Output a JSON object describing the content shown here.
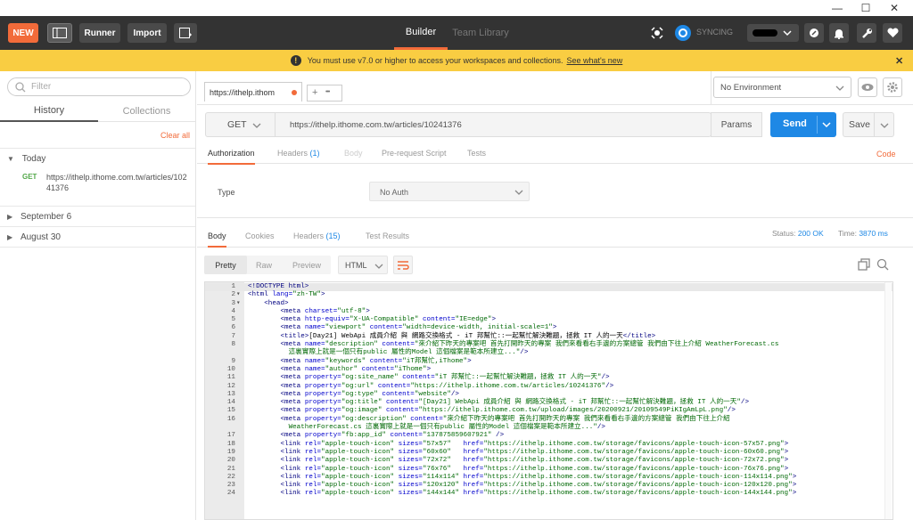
{
  "window": {
    "minimize": "—",
    "maximize": "☐",
    "close": "✕"
  },
  "topbar": {
    "new_label": "NEW",
    "runner_label": "Runner",
    "import_label": "Import",
    "builder_tab": "Builder",
    "team_library_tab": "Team Library",
    "syncing_label": "SYNCING",
    "accent": "#f26b3a",
    "dark": "#333333"
  },
  "banner": {
    "message": "You must use v7.0 or higher to access your workspaces and collections.",
    "link": "See what's new",
    "close": "✕",
    "color": "#f9cd42"
  },
  "sidebar": {
    "filter_placeholder": "Filter",
    "tabs": [
      "History",
      "Collections"
    ],
    "clear_all": "Clear all",
    "groups": [
      {
        "label": "Today",
        "expanded": true,
        "items": [
          {
            "method": "GET",
            "url": "https://ithelp.ithome.com.tw/articles/10241376"
          }
        ]
      },
      {
        "label": "September 6",
        "expanded": false
      },
      {
        "label": "August 30",
        "expanded": false
      }
    ]
  },
  "request_tab": {
    "title": "https://ithelp.ithom",
    "add": "+",
    "more": "•••"
  },
  "environment": {
    "selected": "No Environment"
  },
  "request": {
    "method": "GET",
    "url": "https://ithelp.ithome.com.tw/articles/10241376",
    "params_label": "Params",
    "send_label": "Send",
    "save_label": "Save"
  },
  "request_subtabs": [
    {
      "label": "Authorization",
      "active": true
    },
    {
      "label": "Headers",
      "count": "(1)"
    },
    {
      "label": "Body",
      "disabled": true
    },
    {
      "label": "Pre-request Script"
    },
    {
      "label": "Tests"
    }
  ],
  "code_link": "Code",
  "auth": {
    "type_label": "Type",
    "type_value": "No Auth"
  },
  "response_tabs": [
    {
      "label": "Body",
      "active": true
    },
    {
      "label": "Cookies"
    },
    {
      "label": "Headers",
      "count": "(15)"
    },
    {
      "label": "Test Results"
    }
  ],
  "status": {
    "status_label": "Status:",
    "status_value": "200 OK",
    "time_label": "Time:",
    "time_value": "3870 ms"
  },
  "view_modes": [
    "Pretty",
    "Raw",
    "Preview"
  ],
  "format": "HTML",
  "code_lines": [
    {
      "n": "1",
      "f": "",
      "parts": [
        [
          "t-tag",
          "<!DOCTYPE html>"
        ]
      ]
    },
    {
      "n": "2",
      "f": "▾",
      "parts": [
        [
          "t-tag",
          "<html "
        ],
        [
          "t-attr",
          "lang="
        ],
        [
          "t-val",
          "\"zh-TW\""
        ],
        [
          "t-tag",
          ">"
        ]
      ]
    },
    {
      "n": "3",
      "f": "▾",
      "parts": [
        [
          "t-tag",
          "    <head>"
        ]
      ]
    },
    {
      "n": "4",
      "f": "",
      "parts": [
        [
          "t-tag",
          "        <meta "
        ],
        [
          "t-attr",
          "charset="
        ],
        [
          "t-val",
          "\"utf-8\""
        ],
        [
          "t-tag",
          ">"
        ]
      ]
    },
    {
      "n": "5",
      "f": "",
      "parts": [
        [
          "t-tag",
          "        <meta "
        ],
        [
          "t-attr",
          "http-equiv="
        ],
        [
          "t-val",
          "\"X-UA-Compatible\""
        ],
        [
          "t-attr",
          " content="
        ],
        [
          "t-val",
          "\"IE=edge\""
        ],
        [
          "t-tag",
          ">"
        ]
      ]
    },
    {
      "n": "6",
      "f": "",
      "parts": [
        [
          "t-tag",
          "        <meta "
        ],
        [
          "t-attr",
          "name="
        ],
        [
          "t-val",
          "\"viewport\""
        ],
        [
          "t-attr",
          " content="
        ],
        [
          "t-val",
          "\"width=device-width, initial-scale=1\""
        ],
        [
          "t-tag",
          ">"
        ]
      ]
    },
    {
      "n": "7",
      "f": "",
      "parts": [
        [
          "t-tag",
          "        <title>"
        ],
        [
          "t-txt",
          "[Day21] WebApi 成員介紹 與 網路交換格式 - iT 邦幫忙::一起幫忙解決難題，拯救 IT 人的一天"
        ],
        [
          "t-tag",
          "</title>"
        ]
      ]
    },
    {
      "n": "8",
      "f": "",
      "parts": [
        [
          "t-tag",
          "        <meta "
        ],
        [
          "t-attr",
          "name="
        ],
        [
          "t-val",
          "\"description\""
        ],
        [
          "t-attr",
          " content="
        ],
        [
          "t-val",
          "\"來介紹下昨天的專案吧 首先打開昨天的專案 我們來看看右手邊的方案總管 我們由下往上介紹 WeatherForecast.cs"
        ]
      ]
    },
    {
      "n": "",
      "f": "",
      "parts": [
        [
          "t-val",
          "          這裏實際上就是一個只有public 屬性的Model 這個檔案是範本所建立...\""
        ],
        [
          "t-tag",
          "/>"
        ]
      ]
    },
    {
      "n": "9",
      "f": "",
      "parts": [
        [
          "t-tag",
          "        <meta "
        ],
        [
          "t-attr",
          "name="
        ],
        [
          "t-val",
          "\"keywords\""
        ],
        [
          "t-attr",
          " content="
        ],
        [
          "t-val",
          "\"iT邦幫忙,iThome\""
        ],
        [
          "t-tag",
          ">"
        ]
      ]
    },
    {
      "n": "10",
      "f": "",
      "parts": [
        [
          "t-tag",
          "        <meta "
        ],
        [
          "t-attr",
          "name="
        ],
        [
          "t-val",
          "\"author\""
        ],
        [
          "t-attr",
          " content="
        ],
        [
          "t-val",
          "\"iThome\""
        ],
        [
          "t-tag",
          ">"
        ]
      ]
    },
    {
      "n": "11",
      "f": "",
      "parts": [
        [
          "t-tag",
          "        <meta "
        ],
        [
          "t-attr",
          "property="
        ],
        [
          "t-val",
          "\"og:site_name\""
        ],
        [
          "t-attr",
          " content="
        ],
        [
          "t-val",
          "\"iT 邦幫忙::一起幫忙解決難題，拯救 IT 人的一天\""
        ],
        [
          "t-tag",
          "/>"
        ]
      ]
    },
    {
      "n": "12",
      "f": "",
      "parts": [
        [
          "t-tag",
          "        <meta "
        ],
        [
          "t-attr",
          "property="
        ],
        [
          "t-val",
          "\"og:url\""
        ],
        [
          "t-attr",
          " content="
        ],
        [
          "t-val",
          "\"https://ithelp.ithome.com.tw/articles/10241376\""
        ],
        [
          "t-tag",
          "/>"
        ]
      ]
    },
    {
      "n": "13",
      "f": "",
      "parts": [
        [
          "t-tag",
          "        <meta "
        ],
        [
          "t-attr",
          "property="
        ],
        [
          "t-val",
          "\"og:type\""
        ],
        [
          "t-attr",
          " content="
        ],
        [
          "t-val",
          "\"website\""
        ],
        [
          "t-tag",
          "/>"
        ]
      ]
    },
    {
      "n": "14",
      "f": "",
      "parts": [
        [
          "t-tag",
          "        <meta "
        ],
        [
          "t-attr",
          "property="
        ],
        [
          "t-val",
          "\"og:title\""
        ],
        [
          "t-attr",
          " content="
        ],
        [
          "t-val",
          "\"[Day21] WebApi 成員介紹 與 網路交換格式 - iT 邦幫忙::一起幫忙解決難題，拯救 IT 人的一天\""
        ],
        [
          "t-tag",
          "/>"
        ]
      ]
    },
    {
      "n": "15",
      "f": "",
      "parts": [
        [
          "t-tag",
          "        <meta "
        ],
        [
          "t-attr",
          "property="
        ],
        [
          "t-val",
          "\"og:image\""
        ],
        [
          "t-attr",
          " content="
        ],
        [
          "t-val",
          "\"https://ithelp.ithome.com.tw/upload/images/20200921/20109549PiKIgAmLpL.png\""
        ],
        [
          "t-tag",
          "/>"
        ]
      ]
    },
    {
      "n": "16",
      "f": "",
      "parts": [
        [
          "t-tag",
          "        <meta "
        ],
        [
          "t-attr",
          "property="
        ],
        [
          "t-val",
          "\"og:description\""
        ],
        [
          "t-attr",
          " content="
        ],
        [
          "t-val",
          "\"來介紹下昨天的專案吧 首先打開昨天的專案 我們來看看右手邊的方案總管 我們由下往上介紹"
        ]
      ]
    },
    {
      "n": "",
      "f": "",
      "parts": [
        [
          "t-val",
          "          WeatherForecast.cs 這裏實際上就是一個只有public 屬性的Model 這個檔案是範本所建立...\""
        ],
        [
          "t-tag",
          "/>"
        ]
      ]
    },
    {
      "n": "17",
      "f": "",
      "parts": [
        [
          "t-tag",
          "        <meta "
        ],
        [
          "t-attr",
          "property="
        ],
        [
          "t-val",
          "\"fb:app_id\""
        ],
        [
          "t-attr",
          " content="
        ],
        [
          "t-val",
          "\"137875859607921\""
        ],
        [
          "t-tag",
          " />"
        ]
      ]
    },
    {
      "n": "18",
      "f": "",
      "parts": [
        [
          "t-tag",
          "        <link "
        ],
        [
          "t-attr",
          "rel="
        ],
        [
          "t-val",
          "\"apple-touch-icon\""
        ],
        [
          "t-attr",
          " sizes="
        ],
        [
          "t-val",
          "\"57x57\""
        ],
        [
          "t-attr",
          "   href="
        ],
        [
          "t-val",
          "\"https://ithelp.ithome.com.tw/storage/favicons/apple-touch-icon-57x57.png\""
        ],
        [
          "t-tag",
          ">"
        ]
      ]
    },
    {
      "n": "19",
      "f": "",
      "parts": [
        [
          "t-tag",
          "        <link "
        ],
        [
          "t-attr",
          "rel="
        ],
        [
          "t-val",
          "\"apple-touch-icon\""
        ],
        [
          "t-attr",
          " sizes="
        ],
        [
          "t-val",
          "\"60x60\""
        ],
        [
          "t-attr",
          "   href="
        ],
        [
          "t-val",
          "\"https://ithelp.ithome.com.tw/storage/favicons/apple-touch-icon-60x60.png\""
        ],
        [
          "t-tag",
          ">"
        ]
      ]
    },
    {
      "n": "20",
      "f": "",
      "parts": [
        [
          "t-tag",
          "        <link "
        ],
        [
          "t-attr",
          "rel="
        ],
        [
          "t-val",
          "\"apple-touch-icon\""
        ],
        [
          "t-attr",
          " sizes="
        ],
        [
          "t-val",
          "\"72x72\""
        ],
        [
          "t-attr",
          "   href="
        ],
        [
          "t-val",
          "\"https://ithelp.ithome.com.tw/storage/favicons/apple-touch-icon-72x72.png\""
        ],
        [
          "t-tag",
          ">"
        ]
      ]
    },
    {
      "n": "21",
      "f": "",
      "parts": [
        [
          "t-tag",
          "        <link "
        ],
        [
          "t-attr",
          "rel="
        ],
        [
          "t-val",
          "\"apple-touch-icon\""
        ],
        [
          "t-attr",
          " sizes="
        ],
        [
          "t-val",
          "\"76x76\""
        ],
        [
          "t-attr",
          "   href="
        ],
        [
          "t-val",
          "\"https://ithelp.ithome.com.tw/storage/favicons/apple-touch-icon-76x76.png\""
        ],
        [
          "t-tag",
          ">"
        ]
      ]
    },
    {
      "n": "22",
      "f": "",
      "parts": [
        [
          "t-tag",
          "        <link "
        ],
        [
          "t-attr",
          "rel="
        ],
        [
          "t-val",
          "\"apple-touch-icon\""
        ],
        [
          "t-attr",
          " sizes="
        ],
        [
          "t-val",
          "\"114x114\""
        ],
        [
          "t-attr",
          " href="
        ],
        [
          "t-val",
          "\"https://ithelp.ithome.com.tw/storage/favicons/apple-touch-icon-114x114.png\""
        ],
        [
          "t-tag",
          ">"
        ]
      ]
    },
    {
      "n": "23",
      "f": "",
      "parts": [
        [
          "t-tag",
          "        <link "
        ],
        [
          "t-attr",
          "rel="
        ],
        [
          "t-val",
          "\"apple-touch-icon\""
        ],
        [
          "t-attr",
          " sizes="
        ],
        [
          "t-val",
          "\"120x120\""
        ],
        [
          "t-attr",
          " href="
        ],
        [
          "t-val",
          "\"https://ithelp.ithome.com.tw/storage/favicons/apple-touch-icon-120x120.png\""
        ],
        [
          "t-tag",
          ">"
        ]
      ]
    },
    {
      "n": "24",
      "f": "",
      "parts": [
        [
          "t-tag",
          "        <link "
        ],
        [
          "t-attr",
          "rel="
        ],
        [
          "t-val",
          "\"apple-touch-icon\""
        ],
        [
          "t-attr",
          " sizes="
        ],
        [
          "t-val",
          "\"144x144\""
        ],
        [
          "t-attr",
          " href="
        ],
        [
          "t-val",
          "\"https://ithelp.ithome.com.tw/storage/favicons/apple-touch-icon-144x144.png\""
        ],
        [
          "t-tag",
          ">"
        ]
      ]
    }
  ]
}
